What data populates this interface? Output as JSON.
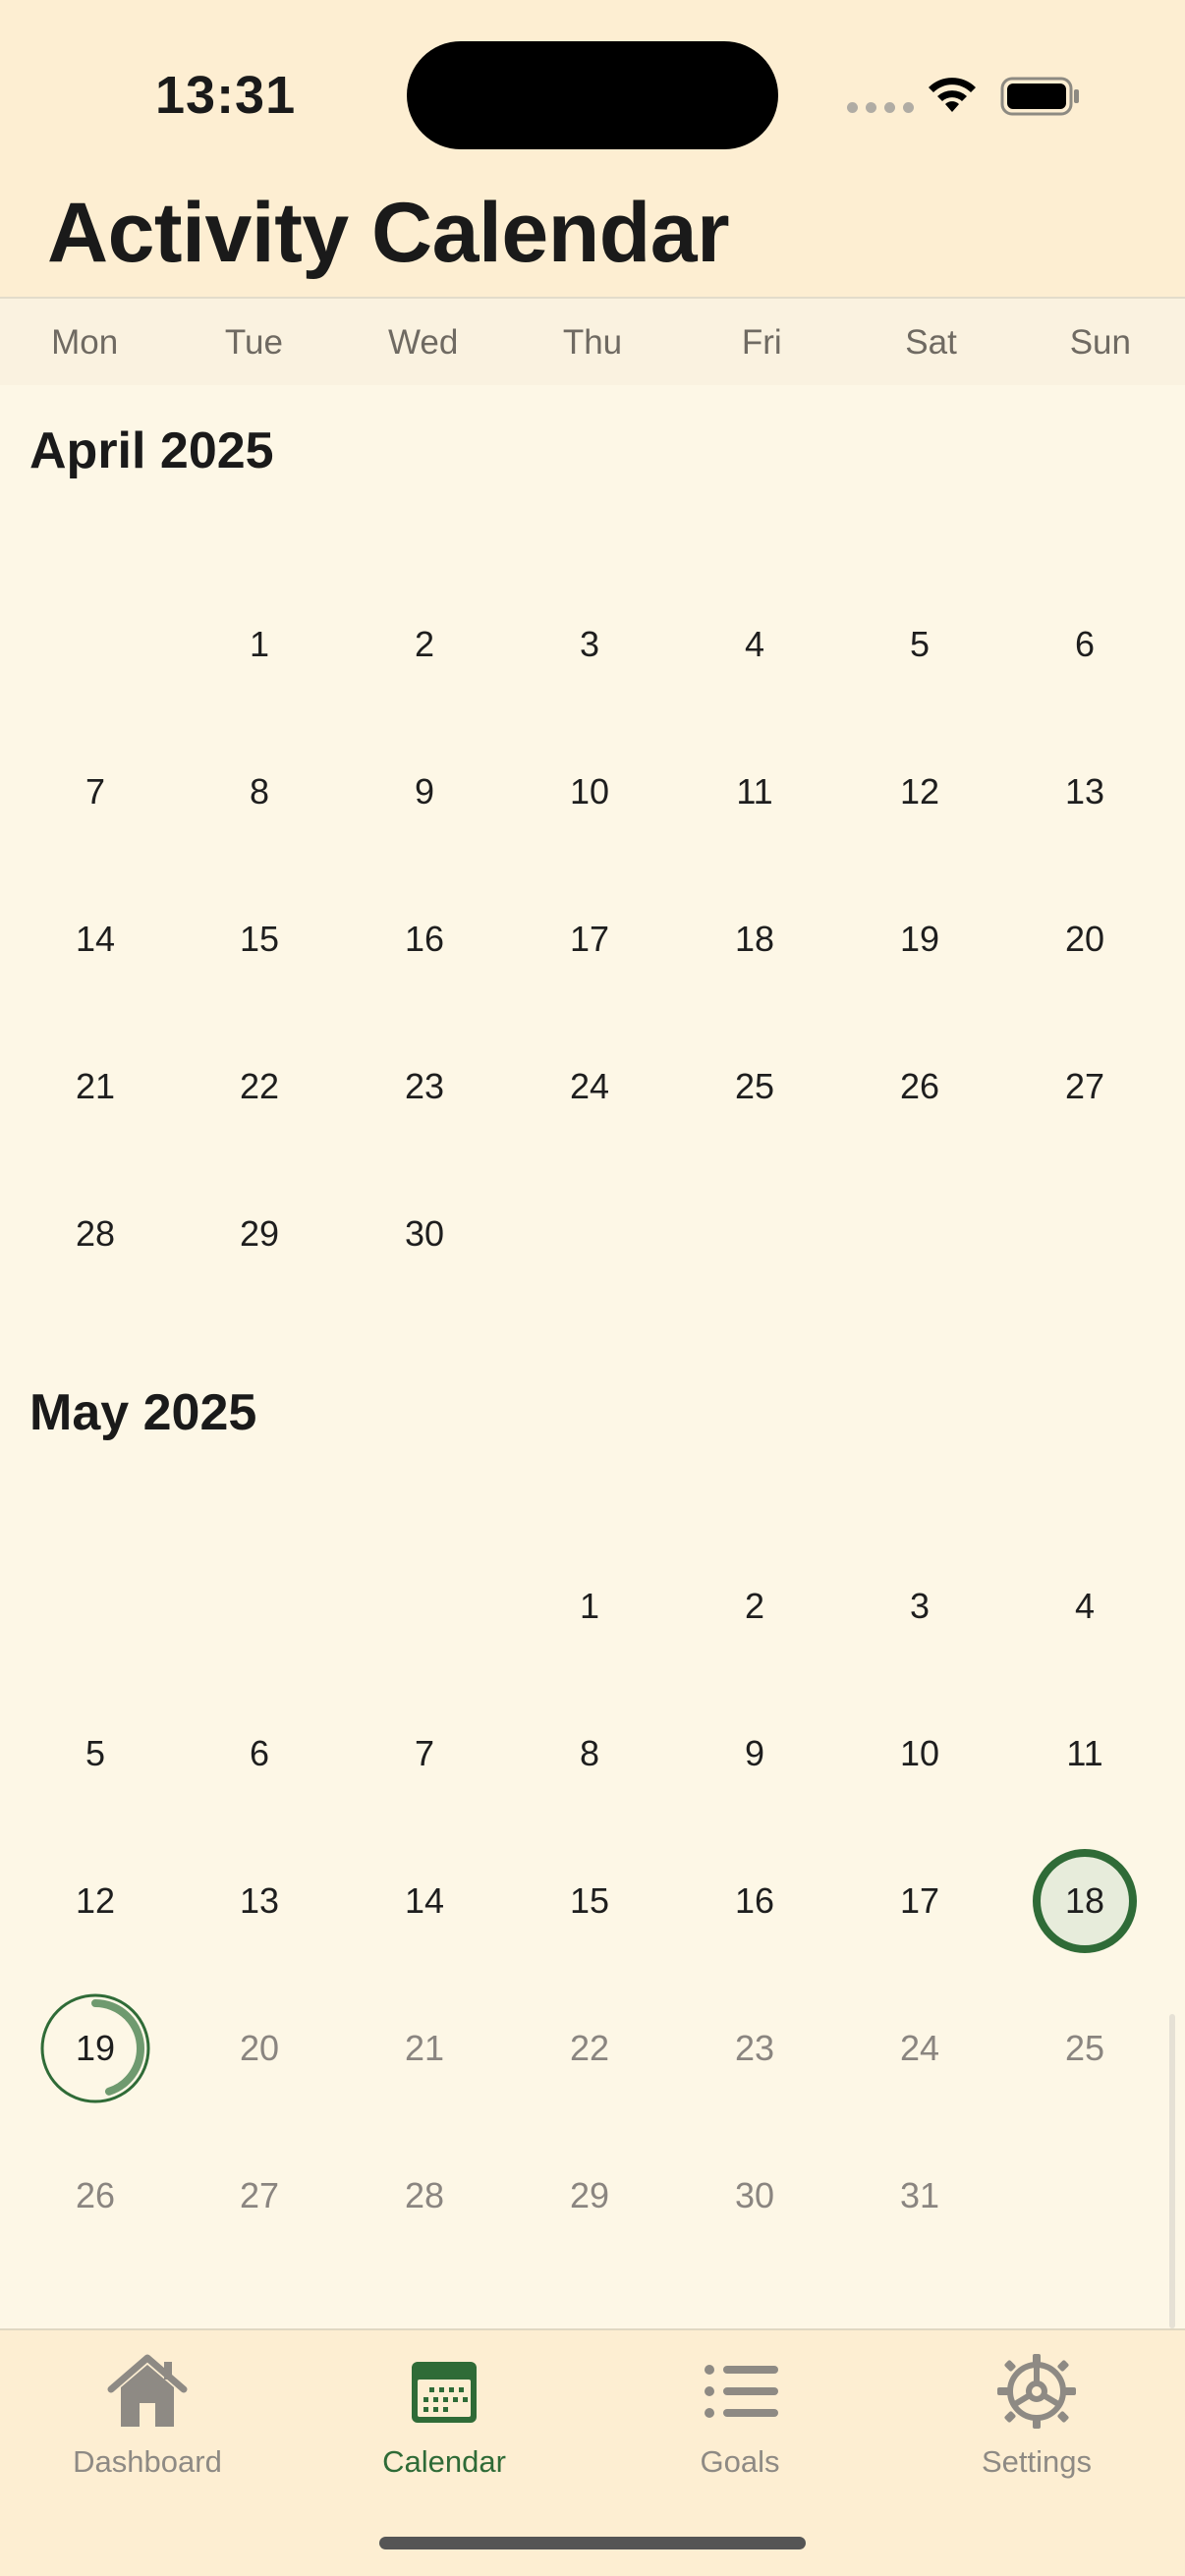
{
  "status_bar": {
    "time": "13:31"
  },
  "header": {
    "title": "Activity Calendar"
  },
  "weekdays": [
    "Mon",
    "Tue",
    "Wed",
    "Thu",
    "Fri",
    "Sat",
    "Sun"
  ],
  "months": [
    {
      "title": "April 2025",
      "start_weekday_index": 1,
      "days": [
        "1",
        "2",
        "3",
        "4",
        "5",
        "6",
        "7",
        "8",
        "9",
        "10",
        "11",
        "12",
        "13",
        "14",
        "15",
        "16",
        "17",
        "18",
        "19",
        "20",
        "21",
        "22",
        "23",
        "24",
        "25",
        "26",
        "27",
        "28",
        "29",
        "30"
      ]
    },
    {
      "title": "May 2025",
      "start_weekday_index": 3,
      "days": [
        "1",
        "2",
        "3",
        "4",
        "5",
        "6",
        "7",
        "8",
        "9",
        "10",
        "11",
        "12",
        "13",
        "14",
        "15",
        "16",
        "17",
        "18",
        "19",
        "20",
        "21",
        "22",
        "23",
        "24",
        "25",
        "26",
        "27",
        "28",
        "29",
        "30",
        "31"
      ]
    }
  ],
  "highlights": {
    "completed_day": {
      "month": "May 2025",
      "day": "18"
    },
    "today": {
      "month": "May 2025",
      "day": "19",
      "progress_fraction": 0.45
    }
  },
  "colors": {
    "accent": "#2f6b37",
    "background": "#fdf7e6",
    "header_bg": "#fdeed2",
    "future_text": "#8a8580"
  },
  "tabs": [
    {
      "label": "Dashboard",
      "icon": "house-icon",
      "active": false
    },
    {
      "label": "Calendar",
      "icon": "calendar-icon",
      "active": true
    },
    {
      "label": "Goals",
      "icon": "list-icon",
      "active": false
    },
    {
      "label": "Settings",
      "icon": "gear-icon",
      "active": false
    }
  ]
}
